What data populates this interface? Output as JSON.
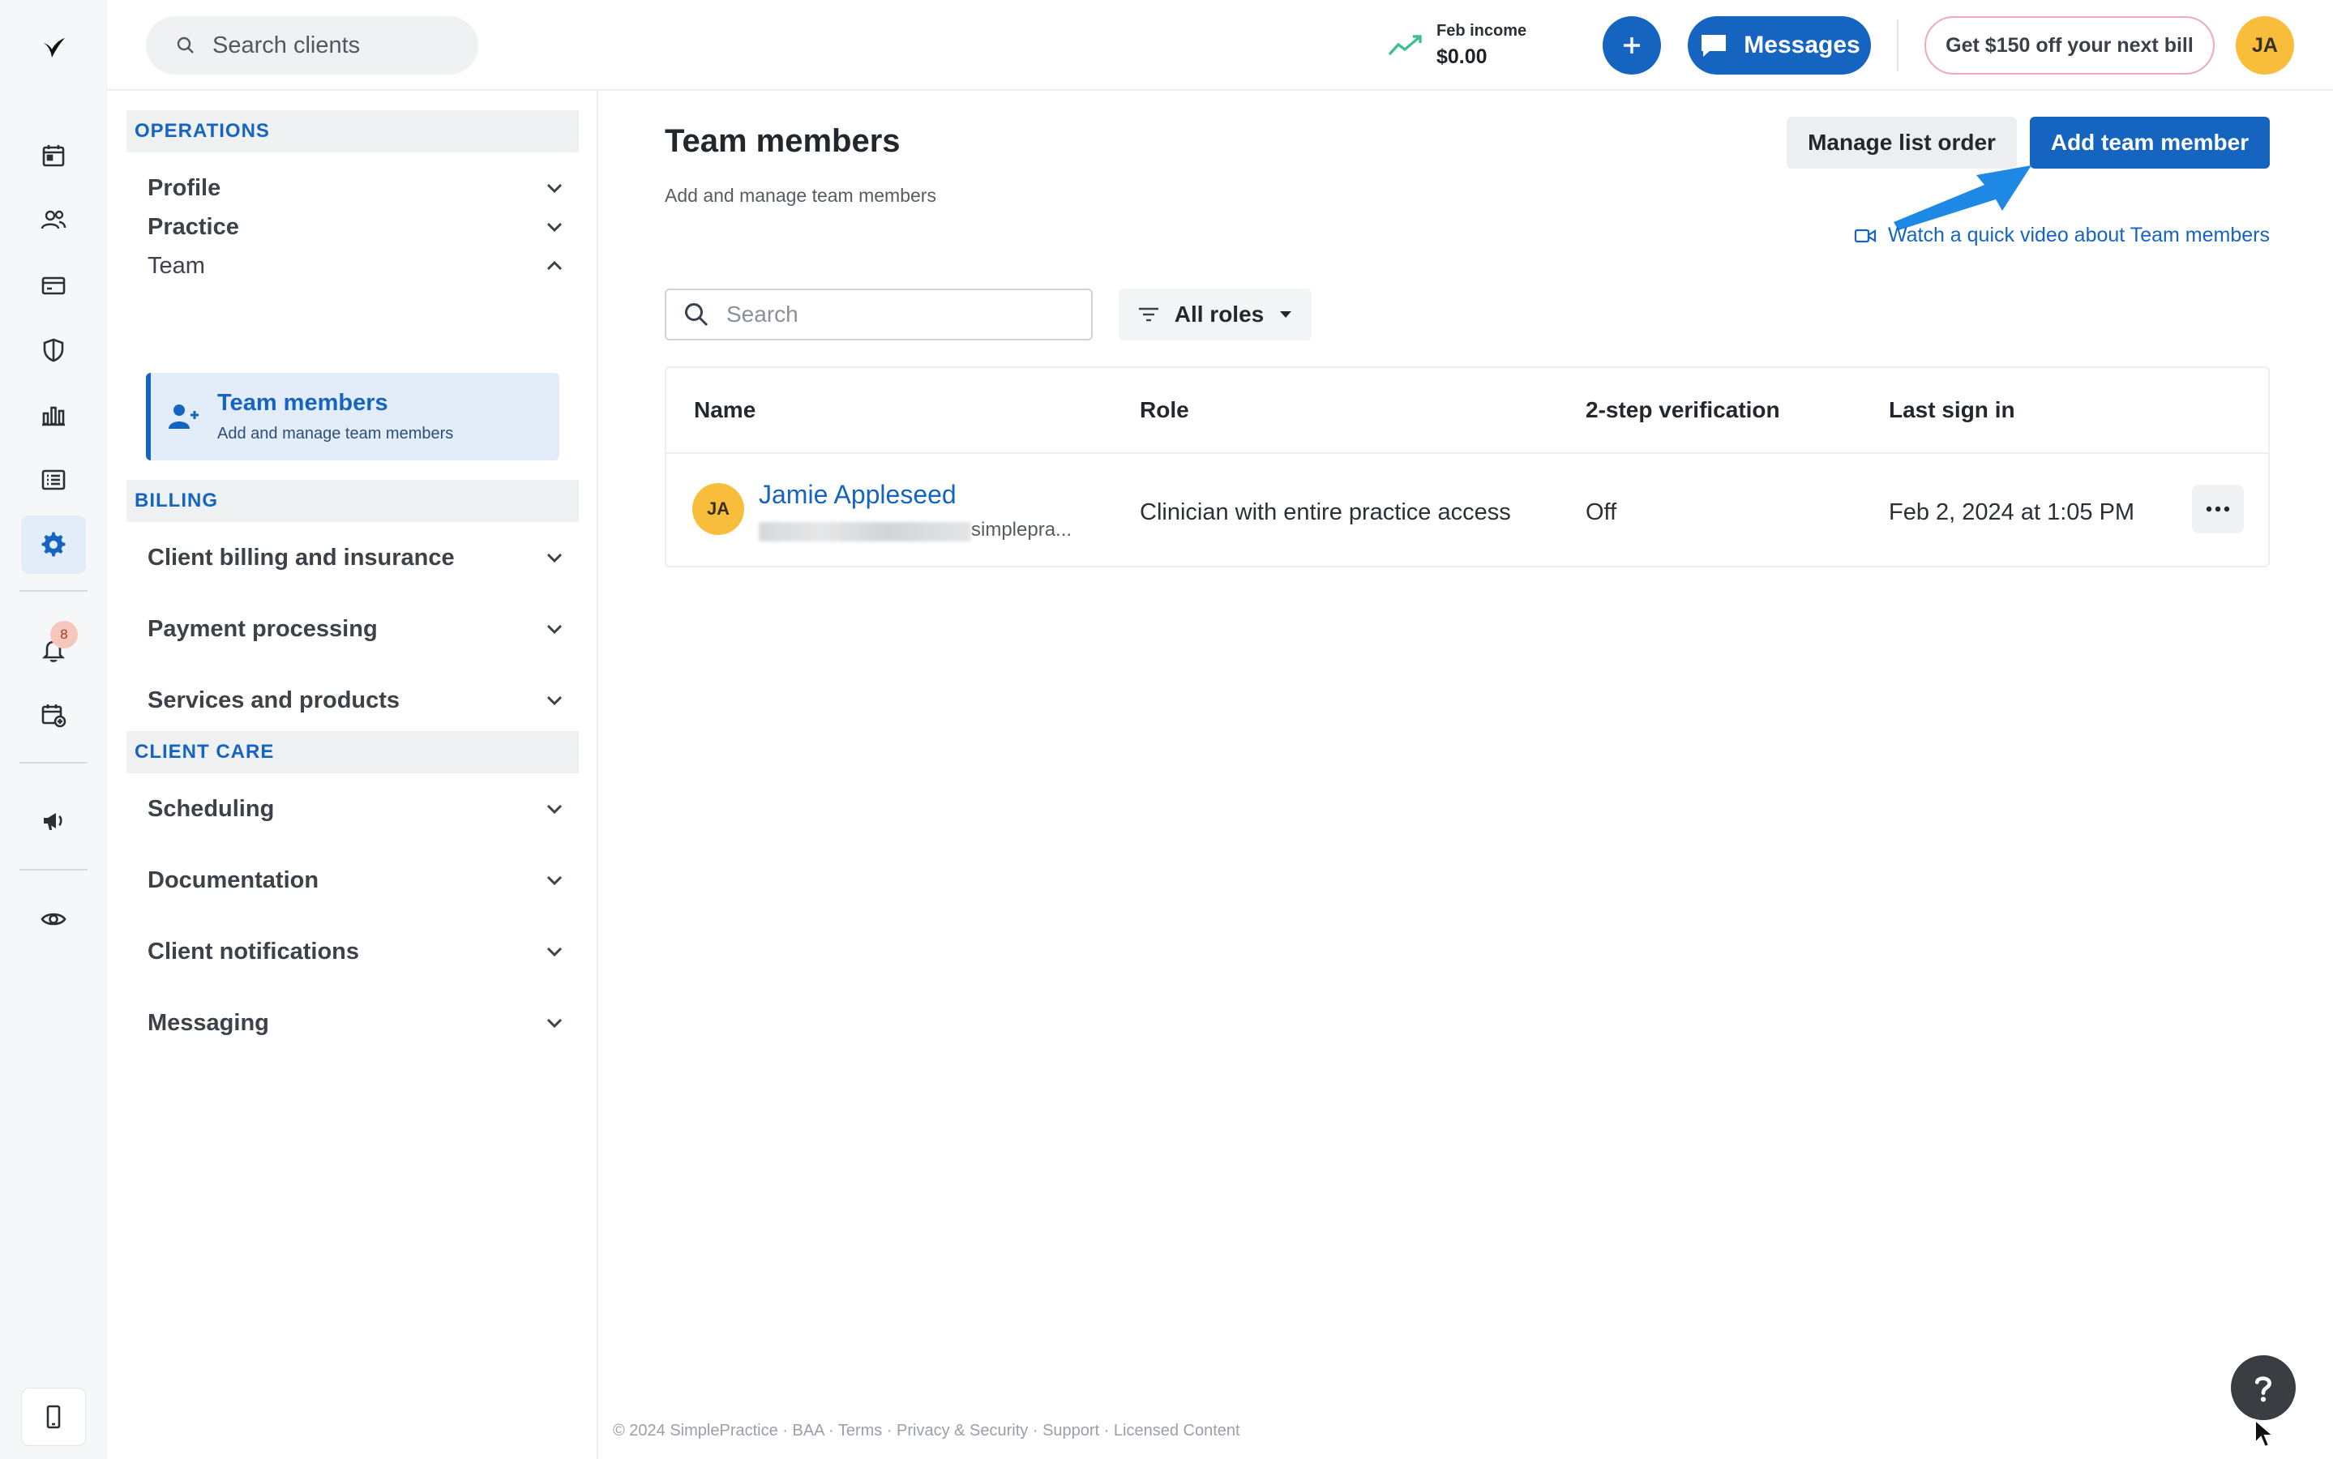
{
  "topbar": {
    "search_placeholder": "Search clients",
    "income_label": "Feb income",
    "income_value": "$0.00",
    "messages_label": "Messages",
    "promo_label": "Get $150 off your next bill",
    "avatar_initials": "JA"
  },
  "rail": {
    "notification_count": "8",
    "icons": [
      "logo-icon",
      "calendar-icon",
      "clients-icon",
      "billing-card-icon",
      "shield-icon",
      "analytics-icon",
      "list-icon",
      "settings-gear-icon",
      "bell-icon",
      "calendar-add-icon",
      "megaphone-icon",
      "eye-icon",
      "mobile-icon"
    ]
  },
  "settings_nav": {
    "operations_header": "OPERATIONS",
    "profile": "Profile",
    "practice": "Practice",
    "team": "Team",
    "team_members_title": "Team members",
    "team_members_sub": "Add and manage team members",
    "billing_header": "BILLING",
    "client_billing": "Client billing and insurance",
    "payment_processing": "Payment processing",
    "services_products": "Services and products",
    "client_care_header": "CLIENT CARE",
    "scheduling": "Scheduling",
    "documentation": "Documentation",
    "client_notifications": "Client notifications",
    "messaging": "Messaging"
  },
  "main": {
    "title": "Team members",
    "subtitle": "Add and manage team members",
    "manage_order_label": "Manage list order",
    "add_member_label": "Add team member",
    "video_link": "Watch a quick video about Team members",
    "search_placeholder": "Search",
    "roles_filter": "All roles",
    "columns": {
      "name": "Name",
      "role": "Role",
      "two_step": "2-step verification",
      "last_sign_in": "Last sign in"
    },
    "rows": [
      {
        "initials": "JA",
        "name": "Jamie Appleseed",
        "email_suffix": "simplepra...",
        "role": "Clinician with entire practice access",
        "two_step": "Off",
        "last_sign_in": "Feb 2, 2024 at 1:05 PM"
      }
    ]
  },
  "footer": "© 2024 SimplePractice · BAA · Terms · Privacy & Security · Support · Licensed Content",
  "colors": {
    "primary": "#1565c0",
    "active_bg": "#e3edf9",
    "avatar": "#f7bd3b",
    "income_trend": "#3fbf8f",
    "annotation_arrow": "#1e88e5"
  }
}
